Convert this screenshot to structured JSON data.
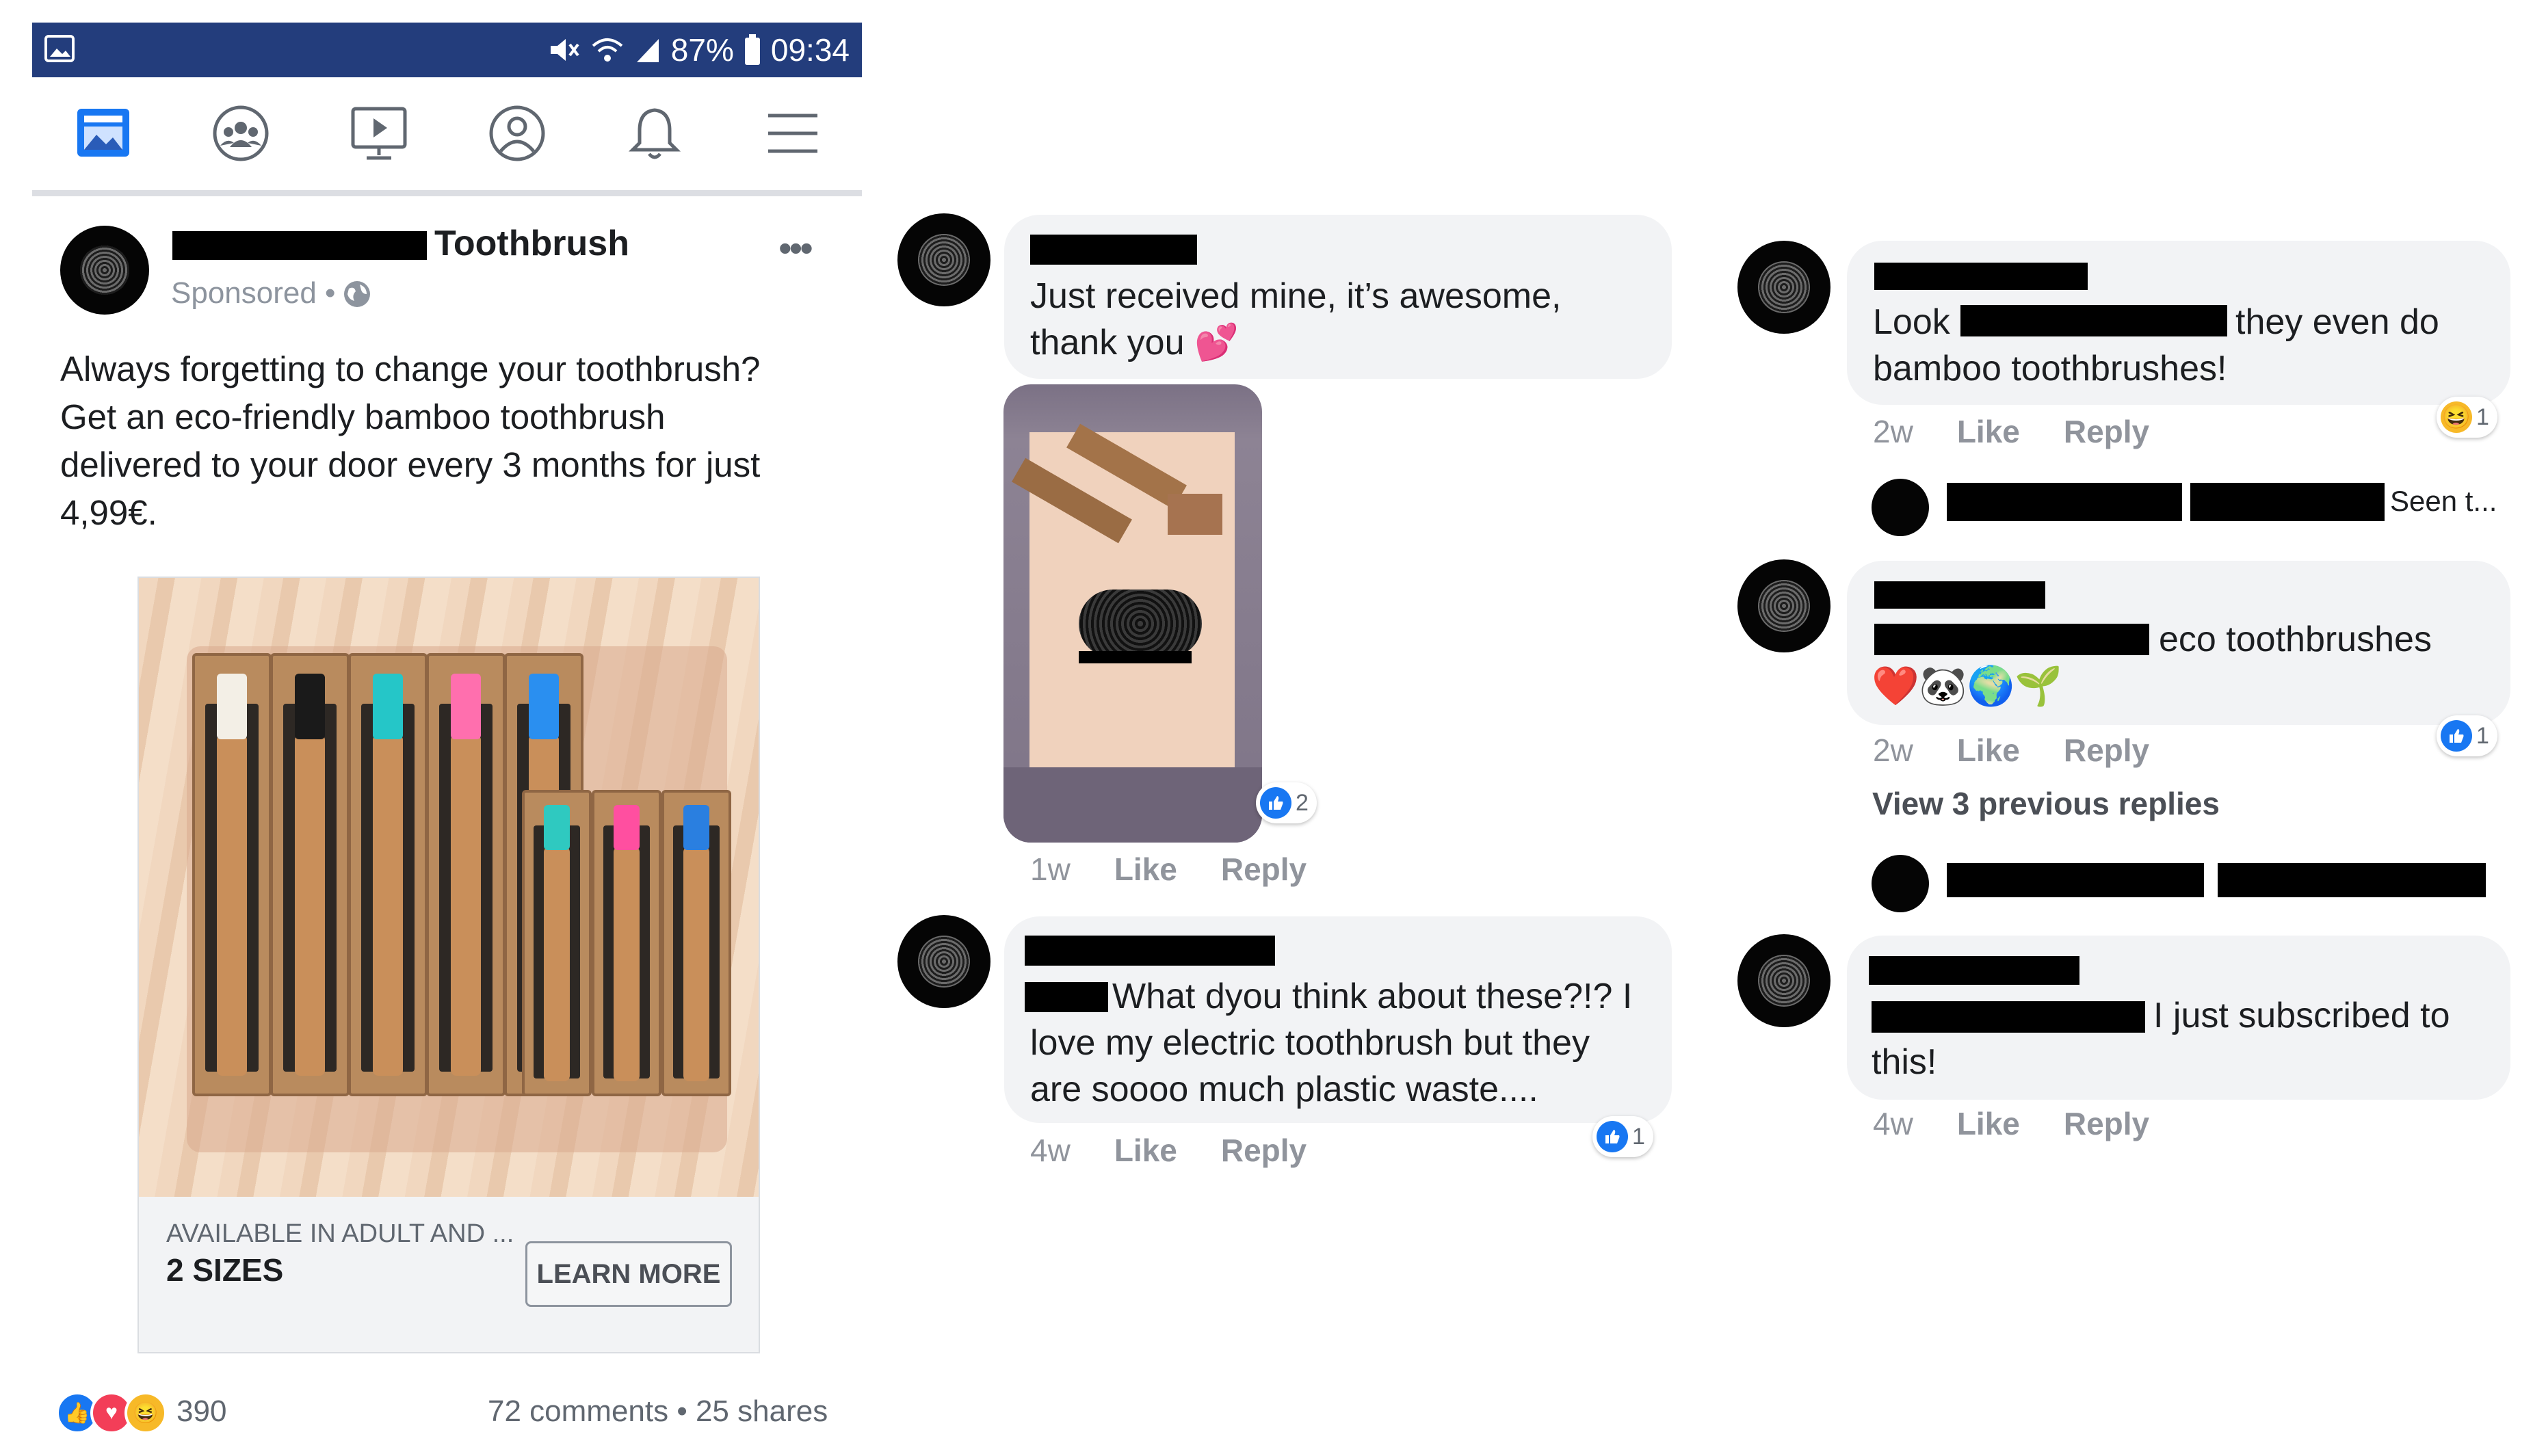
{
  "status_bar": {
    "battery": "87%",
    "time": "09:34"
  },
  "nav_icons": [
    "news-feed-icon",
    "groups-icon",
    "watch-icon",
    "profile-icon",
    "notifications-icon",
    "menu-icon"
  ],
  "post": {
    "page_name": "Toothbrush",
    "sponsored": "Sponsored •",
    "text_lines": [
      "Always forgetting to change your toothbrush?",
      "Get an eco-friendly bamboo toothbrush",
      "delivered to your door every 3 months for just",
      "4,99€."
    ],
    "ad": {
      "caption_small": "AVAILABLE IN ADULT AND ...",
      "caption_big": "2 SIZES",
      "cta": "LEARN MORE"
    },
    "reaction_count": "390",
    "comments_shares": "72 comments • 25 shares"
  },
  "comments": [
    {
      "lines": [
        "Just received mine, it’s awesome,",
        "thank you 💕"
      ],
      "time": "1w",
      "like": "Like",
      "reply": "Reply",
      "reactions": "2"
    },
    {
      "lines": [
        "What dyou think about these?!? I",
        "love my electric toothbrush but they",
        "are soooo much plastic waste...."
      ],
      "time": "4w",
      "like": "Like",
      "reply": "Reply",
      "reactions": "1"
    },
    {
      "line1_a": "Look",
      "line1_b": "they even do",
      "line2": "bamboo toothbrushes!",
      "time": "2w",
      "like": "Like",
      "reply": "Reply",
      "reactions": "1"
    },
    {
      "seen": "Seen t..."
    },
    {
      "line1": "eco toothbrushes",
      "line2": "❤️🐼🌍🌱",
      "time": "2w",
      "like": "Like",
      "reply": "Reply",
      "reactions": "1"
    },
    {
      "view_previous": "View 3 previous replies"
    },
    {
      "line1": "I just subscribed to",
      "line2": "this!",
      "time": "4w",
      "like": "Like",
      "reply": "Reply"
    }
  ],
  "colors": {
    "status_bar": "#233d7c",
    "like_blue": "#1877f2",
    "bubble": "#f2f3f5"
  }
}
